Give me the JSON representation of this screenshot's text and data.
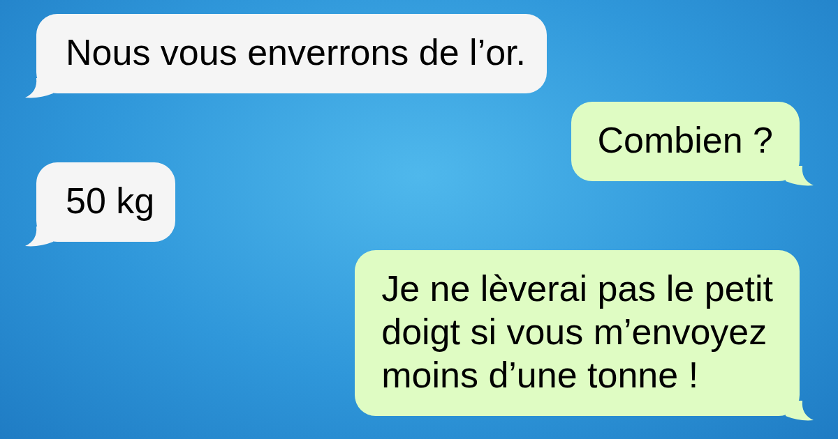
{
  "messages": [
    {
      "kind": "incoming",
      "text": "Nous vous enverrons de l’or."
    },
    {
      "kind": "outgoing",
      "text": "Combien ?"
    },
    {
      "kind": "incoming",
      "text": "50 kg"
    },
    {
      "kind": "outgoing",
      "text": "Je ne lèverai pas le petit\ndoigt si vous m’envoyez\nmoins d’une tonne !"
    }
  ]
}
